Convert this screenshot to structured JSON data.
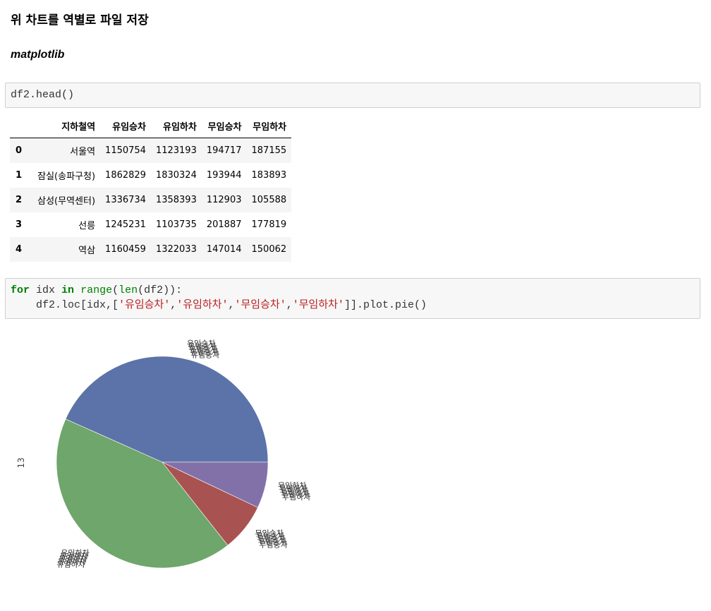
{
  "heading": "위 차트를 역별로 파일 저장",
  "subheading": "matplotlib",
  "cell1": {
    "code": "df2.head()"
  },
  "table": {
    "columns": [
      "지하철역",
      "유임승차",
      "유임하차",
      "무임승차",
      "무임하차"
    ],
    "rows": [
      {
        "index": "0",
        "cells": [
          "서울역",
          "1150754",
          "1123193",
          "194717",
          "187155"
        ]
      },
      {
        "index": "1",
        "cells": [
          "잠실(송파구청)",
          "1862829",
          "1830324",
          "193944",
          "183893"
        ]
      },
      {
        "index": "2",
        "cells": [
          "삼성(무역센터)",
          "1336734",
          "1358393",
          "112903",
          "105588"
        ]
      },
      {
        "index": "3",
        "cells": [
          "선릉",
          "1245231",
          "1103735",
          "201887",
          "177819"
        ]
      },
      {
        "index": "4",
        "cells": [
          "역삼",
          "1160459",
          "1322033",
          "147014",
          "150062"
        ]
      }
    ]
  },
  "cell2": {
    "for_kw": "for",
    "var1": " idx ",
    "in_kw": "in",
    "range_fn": "range",
    "p1": "(",
    "len_fn": "len",
    "p2": "(df2)):",
    "line2_a": "    df2.loc[idx,[",
    "s1": "'유임승차'",
    "s2": "'유임하차'",
    "s3": "'무임승차'",
    "s4": "'무임하차'",
    "comma": ",",
    "line2_b": "]].plot.pie()"
  },
  "chart_data": {
    "type": "pie",
    "ylabel": "13",
    "categories": [
      "유임승차",
      "유임하차",
      "무임승차",
      "무임하차"
    ],
    "values": [
      1150754,
      1123193,
      194717,
      187155
    ],
    "colors": [
      "#5b73a8",
      "#6fa66b",
      "#a95252",
      "#8271a8"
    ],
    "labels_overlap": true
  }
}
